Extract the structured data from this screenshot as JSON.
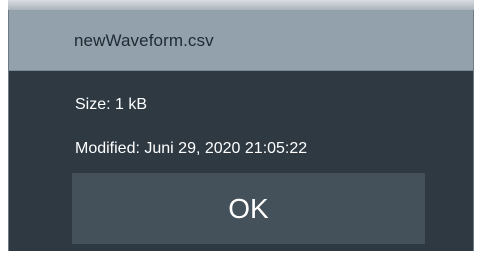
{
  "dialog": {
    "title": "newWaveform.csv",
    "size_text": "Size: 1 kB",
    "modified_text": "Modified: Juni 29, 2020 21:05:22",
    "ok_label": "OK"
  },
  "colors": {
    "header_bg": "#93a1ac",
    "body_bg": "#2e3942",
    "button_bg": "#45515a",
    "text_light": "#ffffff",
    "text_dark": "#1f2a33"
  }
}
